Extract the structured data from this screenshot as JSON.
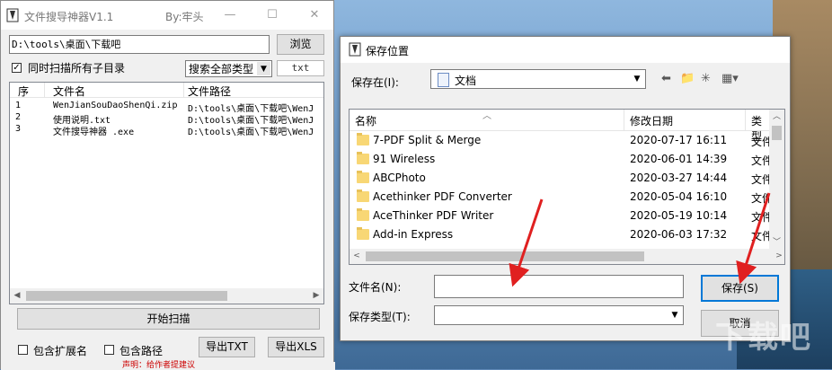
{
  "app": {
    "title": "文件搜导神器V1.1",
    "author": "By:牢头",
    "path": "D:\\tools\\桌面\\下载吧",
    "browse_label": "浏览",
    "subdir_label": "同时扫描所有子目录",
    "type_select": "搜索全部类型",
    "ext_value": "txt",
    "list_headers": {
      "num": "序",
      "name": "文件名",
      "path": "文件路径"
    },
    "rows": [
      {
        "num": "1",
        "name": "WenJianSouDaoShenQi.zip",
        "path": "D:\\tools\\桌面\\下载吧\\WenJ"
      },
      {
        "num": "2",
        "name": "使用说明.txt",
        "path": "D:\\tools\\桌面\\下载吧\\WenJ"
      },
      {
        "num": "3",
        "name": "文件搜导神器 .exe",
        "path": "D:\\tools\\桌面\\下载吧\\WenJ"
      }
    ],
    "scan_label": "开始扫描",
    "include_ext_label": "包含扩展名",
    "include_path_label": "包含路径",
    "export_txt_label": "导出TXT",
    "export_xls_label": "导出XLS",
    "footer_text": "声明：给作者提建议"
  },
  "dialog": {
    "title": "保存位置",
    "save_in_label": "保存在(I):",
    "location": "文档",
    "headers": {
      "name": "名称",
      "date": "修改日期",
      "type": "类型"
    },
    "folders": [
      {
        "name": "7-PDF Split & Merge",
        "date": "2020-07-17 16:11",
        "type": "文件"
      },
      {
        "name": "91 Wireless",
        "date": "2020-06-01 14:39",
        "type": "文件"
      },
      {
        "name": "ABCPhoto",
        "date": "2020-03-27 14:44",
        "type": "文件"
      },
      {
        "name": "Acethinker PDF Converter",
        "date": "2020-05-04 16:10",
        "type": "文件"
      },
      {
        "name": "AceThinker PDF Writer",
        "date": "2020-05-19 10:14",
        "type": "文件"
      },
      {
        "name": "Add-in Express",
        "date": "2020-06-03 17:32",
        "type": "文件"
      }
    ],
    "filename_label": "文件名(N):",
    "filename_value": "",
    "filetype_label": "保存类型(T):",
    "filetype_value": "",
    "save_label": "保存(S)",
    "cancel_label": "取消"
  },
  "watermark": "下载吧",
  "colors": {
    "accent": "#0078d7",
    "arrow": "#e02020",
    "folder": "#f8d775"
  }
}
